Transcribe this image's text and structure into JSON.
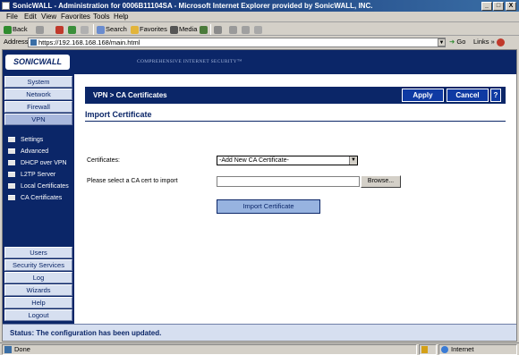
{
  "window": {
    "title": "SonicWALL - Administration for 0006B11104SA - Microsoft Internet Explorer provided by SonicWALL, INC.",
    "controls": [
      "_",
      "□",
      "X"
    ]
  },
  "menu": [
    "File",
    "Edit",
    "View",
    "Favorites",
    "Tools",
    "Help"
  ],
  "toolbar": {
    "back": "Back",
    "search": "Search",
    "favorites": "Favorites",
    "media": "Media"
  },
  "address": {
    "label": "Address",
    "url": "https://192.168.168.168/main.html",
    "go": "Go",
    "links": "Links"
  },
  "header": {
    "logo": "SONICWALL",
    "tagline": "COMPREHENSIVE INTERNET SECURITY™"
  },
  "sidebar": {
    "top_buttons": [
      "System",
      "Network",
      "Firewall",
      "VPN"
    ],
    "sub_items": [
      "Settings",
      "Advanced",
      "DHCP over VPN",
      "L2TP Server",
      "Local Certificates",
      "CA Certificates"
    ],
    "bottom_buttons": [
      "Users",
      "Security Services",
      "Log",
      "Wizards",
      "Help",
      "Logout"
    ]
  },
  "content": {
    "title": "VPN > CA Certificates",
    "apply": "Apply",
    "cancel": "Cancel",
    "help": "?",
    "section": "Import Certificate",
    "cert_label": "Certificates:",
    "cert_value": "-Add New CA Certificate-",
    "file_label": "Please select a CA cert to import",
    "browse": "Browse...",
    "import": "Import Certificate"
  },
  "status": {
    "text": "Status: The configuration has been updated."
  },
  "ie_status": {
    "left": "Done",
    "zone": "Internet"
  }
}
